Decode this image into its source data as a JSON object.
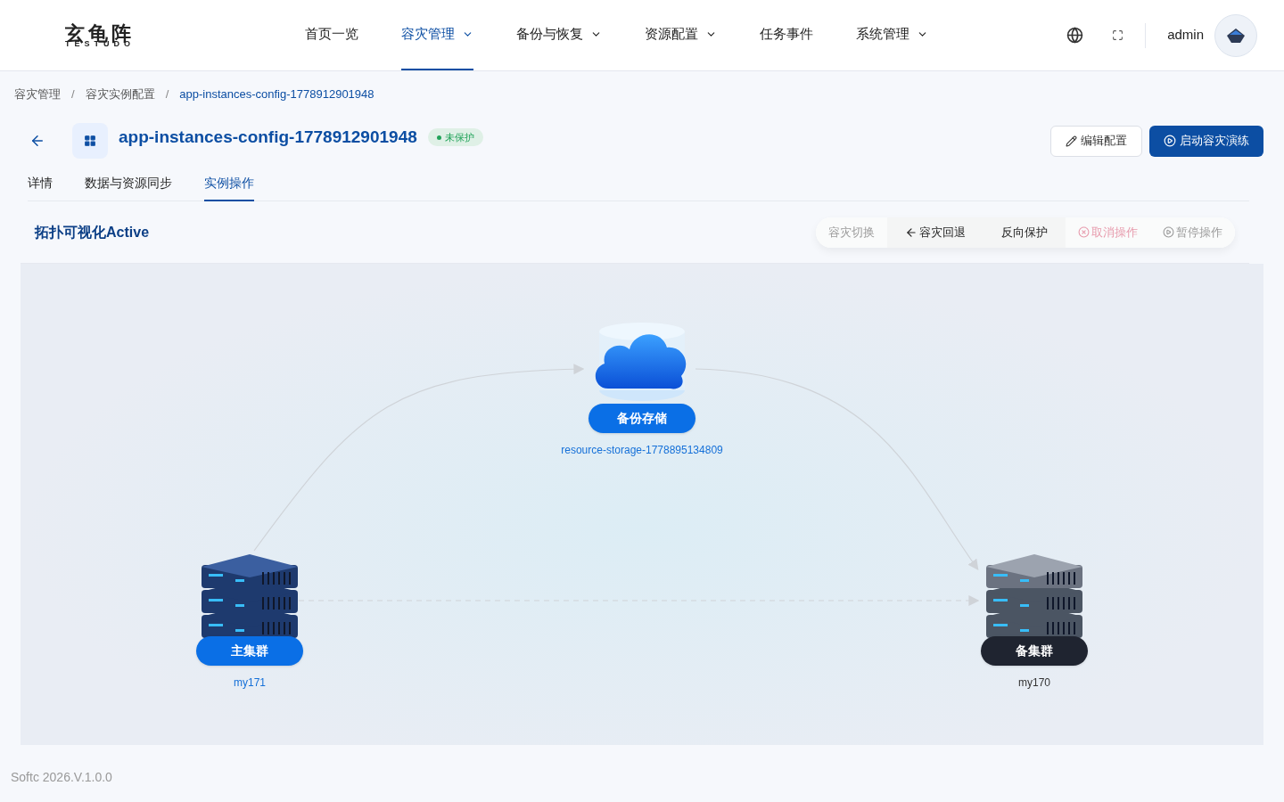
{
  "logo": {
    "name": "玄龟阵",
    "sub": "TESTUDO"
  },
  "nav": [
    {
      "label": "首页一览",
      "selected": false,
      "dropdown": false
    },
    {
      "label": "容灾管理",
      "selected": true,
      "dropdown": true
    },
    {
      "label": "备份与恢复",
      "selected": false,
      "dropdown": true
    },
    {
      "label": "资源配置",
      "selected": false,
      "dropdown": true
    },
    {
      "label": "任务事件",
      "selected": false,
      "dropdown": false
    },
    {
      "label": "系统管理",
      "selected": false,
      "dropdown": true
    }
  ],
  "user": {
    "name": "admin"
  },
  "breadcrumb": [
    {
      "kind": "link",
      "label": "容灾管理",
      "current": false
    },
    {
      "kind": "separator",
      "label": "/"
    },
    {
      "kind": "link",
      "label": "容灾实例配置",
      "current": false
    },
    {
      "kind": "separator",
      "label": "/"
    },
    {
      "kind": "link",
      "label": "app-instances-config-1778912901948",
      "current": true
    }
  ],
  "header": {
    "title": "app-instances-config-1778912901948",
    "status": {
      "label": "未保护",
      "color": "#22a35a"
    },
    "buttons": [
      {
        "label": "编辑配置",
        "kind": "edit"
      },
      {
        "label": "启动容灾演练",
        "kind": "primary"
      }
    ]
  },
  "tabs": [
    {
      "label": "详情",
      "selected": false
    },
    {
      "label": "数据与资源同步",
      "selected": false
    },
    {
      "label": "实例操作",
      "selected": true
    }
  ],
  "section": {
    "title": "拓扑可视化Active"
  },
  "operations": [
    {
      "label": "容灾切换",
      "kind": "plain",
      "disabled": true
    },
    {
      "label": "容灾回退",
      "kind": "back",
      "disabled": false
    },
    {
      "label": "反向保护",
      "kind": "plain",
      "disabled": false
    },
    {
      "label": "取消操作",
      "kind": "cancel",
      "disabled": true
    },
    {
      "label": "暂停操作",
      "kind": "pause",
      "disabled": true
    }
  ],
  "topology": {
    "nodes": [
      {
        "kind": "storage",
        "label": "备份存储",
        "name": "resource-storage-1778895134809"
      },
      {
        "kind": "primary",
        "label": "主集群",
        "name": "my171"
      },
      {
        "kind": "standby",
        "label": "备集群",
        "name": "my170"
      }
    ]
  },
  "footer": "Softc 2026.V.1.0.0"
}
